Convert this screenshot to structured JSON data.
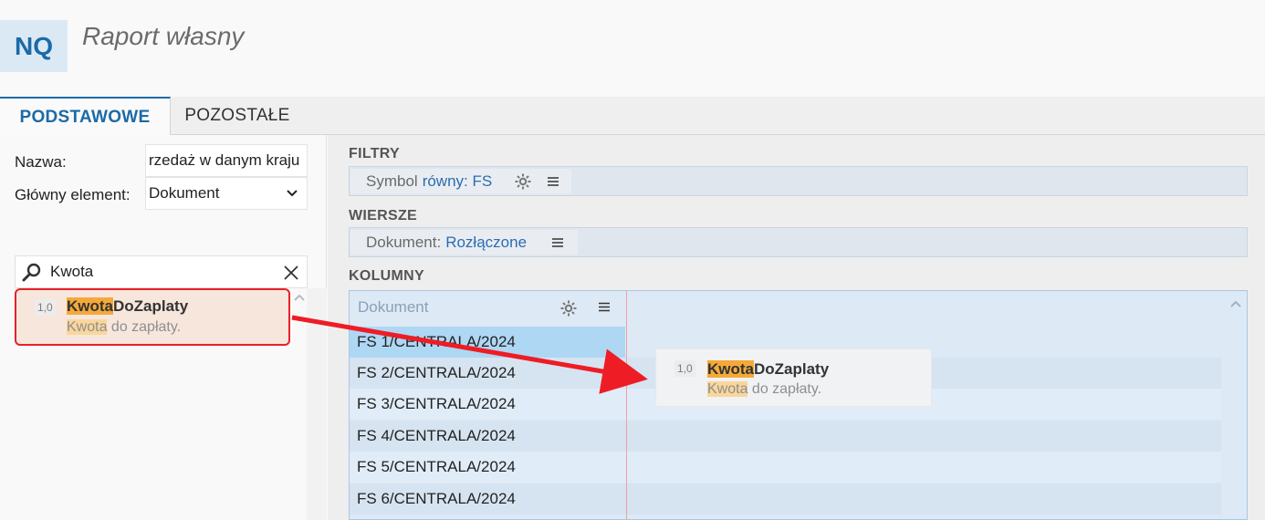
{
  "app": {
    "logo": "NQ",
    "title": "Raport własny"
  },
  "tabs": [
    {
      "label": "PODSTAWOWE",
      "active": true
    },
    {
      "label": "POZOSTAŁE",
      "active": false
    }
  ],
  "form": {
    "name_label": "Nazwa:",
    "name_value": "rzedaż w danym kraju",
    "main_element_label": "Główny element:",
    "main_element_value": "Dokument"
  },
  "search": {
    "value": "Kwota"
  },
  "search_result": {
    "tag": "1,0",
    "name_match": "Kwota",
    "name_rest": "DoZaplaty",
    "desc_match": "Kwota",
    "desc_rest": " do zapłaty."
  },
  "sections": {
    "filters": {
      "title": "FILTRY",
      "chip_label": "Symbol",
      "chip_value": "równy: FS"
    },
    "rows": {
      "title": "WIERSZE",
      "chip_label": "Dokument:",
      "chip_value": "Rozłączone"
    },
    "columns": {
      "title": "KOLUMNY",
      "header": "Dokument",
      "items": [
        "FS 1/CENTRALA/2024",
        "FS 2/CENTRALA/2024",
        "FS 3/CENTRALA/2024",
        "FS 4/CENTRALA/2024",
        "FS 5/CENTRALA/2024",
        "FS 6/CENTRALA/2024"
      ]
    }
  },
  "drag_ghost": {
    "tag": "1,0",
    "name_match": "Kwota",
    "name_rest": "DoZaplaty",
    "desc_match": "Kwota",
    "desc_rest": " do zapłaty."
  },
  "colors": {
    "accent": "#1c6aa6",
    "highlight": "#f5a93a",
    "annotation_red": "#e8212a",
    "selected_row": "#aed7f4"
  },
  "icons": [
    "search-icon",
    "close-icon",
    "chevron-down-icon",
    "gear-icon",
    "menu-icon",
    "chevron-up-icon"
  ]
}
